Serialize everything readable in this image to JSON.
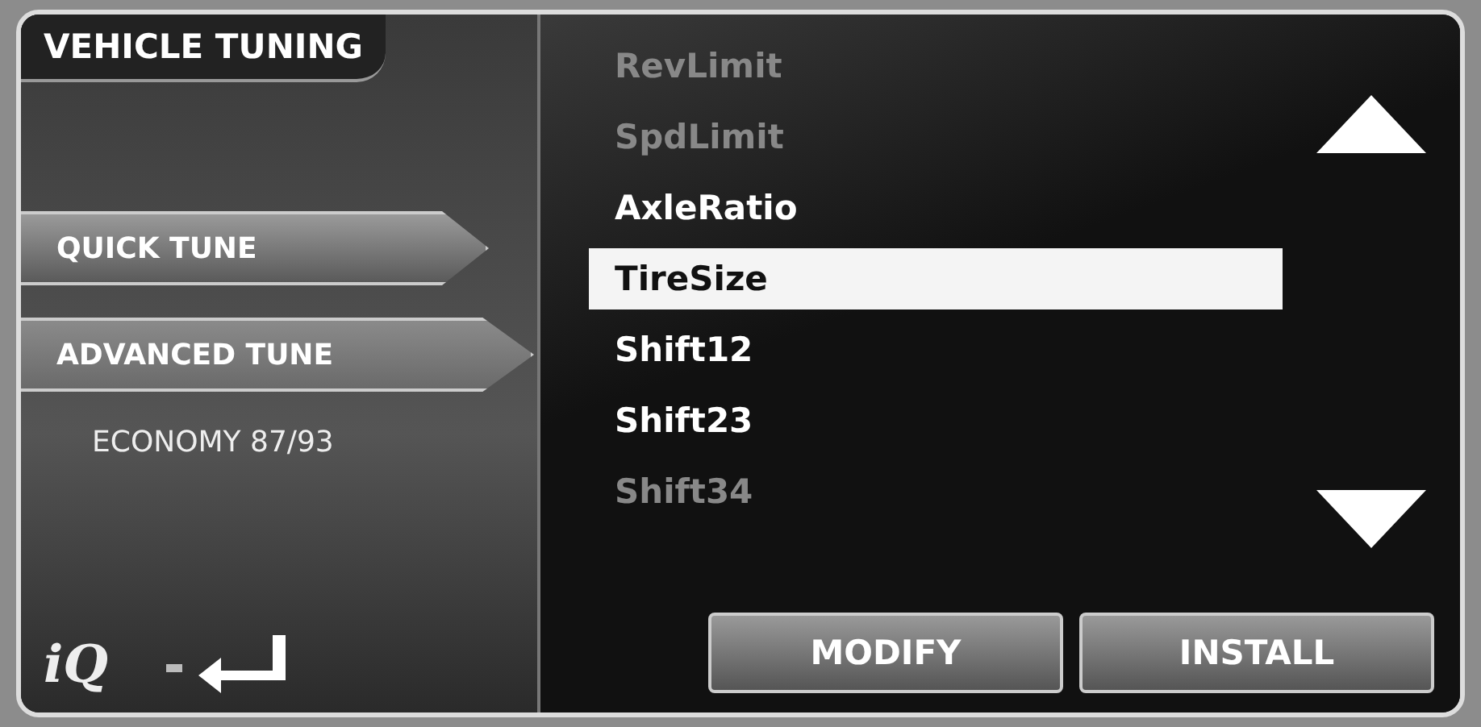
{
  "title": "VEHICLE TUNING",
  "menu": [
    {
      "label": "QUICK TUNE",
      "kind": "tab",
      "selected": false
    },
    {
      "label": "ADVANCED TUNE",
      "kind": "tab",
      "selected": true
    },
    {
      "label": "ECONOMY 87/93",
      "kind": "option",
      "selected": false
    }
  ],
  "logo": "iQ",
  "parameters": [
    {
      "label": "RevLimit",
      "dimmed": true,
      "selected": false
    },
    {
      "label": "SpdLimit",
      "dimmed": true,
      "selected": false
    },
    {
      "label": "AxleRatio",
      "dimmed": false,
      "selected": false
    },
    {
      "label": "TireSize",
      "dimmed": false,
      "selected": true
    },
    {
      "label": "Shift12",
      "dimmed": false,
      "selected": false
    },
    {
      "label": "Shift23",
      "dimmed": false,
      "selected": false
    },
    {
      "label": "Shift34",
      "dimmed": true,
      "selected": false
    }
  ],
  "buttons": [
    "MODIFY",
    "INSTALL"
  ]
}
